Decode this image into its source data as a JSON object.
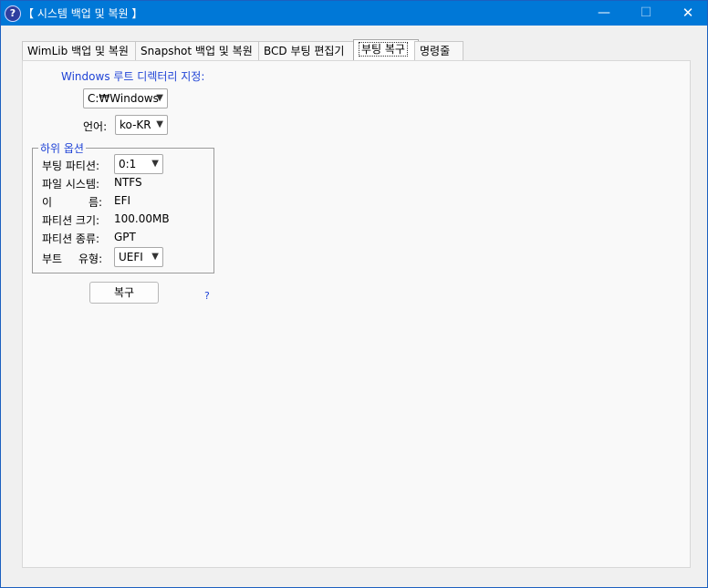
{
  "window": {
    "title": "【 시스템 백업 및 복원 】",
    "icon": "help-question-icon"
  },
  "tabs": [
    {
      "label": "WimLib 백업 및 복원"
    },
    {
      "label": "Snapshot 백업 및 복원"
    },
    {
      "label": "BCD 부팅 편집기"
    },
    {
      "label": "부팅 복구"
    },
    {
      "label": "명령줄"
    }
  ],
  "active_tab": "부팅 복구",
  "root_dir": {
    "label": "Windows 루트 디렉터리 지정:",
    "value": "C:₩Windows"
  },
  "language": {
    "label": "언어:",
    "value": "ko-KR"
  },
  "sub_options": {
    "title": "하위 옵션",
    "boot_partition_label": "부팅 파티션:",
    "boot_partition_value": "0:1",
    "filesystem_label": "파일 시스템:",
    "filesystem_value": "NTFS",
    "name_label_1": "이",
    "name_label_2": "름:",
    "name_value": "EFI",
    "size_label": "파티션 크기:",
    "size_value": "100.00MB",
    "type_label": "파티션 종류:",
    "type_value": "GPT",
    "boot_type_label_1": "부트",
    "boot_type_label_2": "유형:",
    "boot_type_value": "UEFI"
  },
  "buttons": {
    "restore": "복구",
    "help": "?"
  },
  "controls": {
    "minimize": "—",
    "maximize": "☐",
    "close": "✕"
  },
  "colors": {
    "titlebar": "#0078d7",
    "accent_text": "#1f43d6",
    "background": "#f0f0f0"
  }
}
